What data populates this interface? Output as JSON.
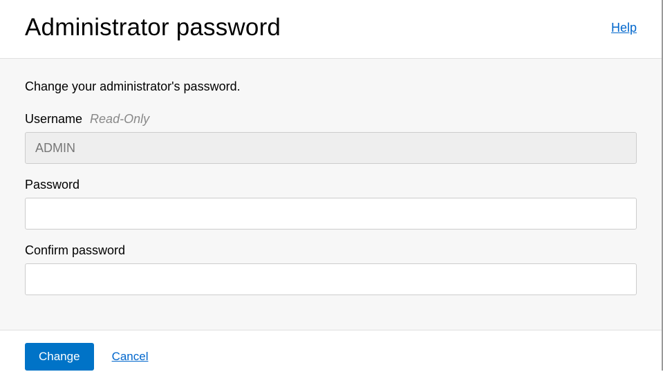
{
  "header": {
    "title": "Administrator password",
    "help_label": "Help"
  },
  "form": {
    "description": "Change your administrator's password.",
    "username": {
      "label": "Username",
      "hint": "Read-Only",
      "value": "ADMIN"
    },
    "password": {
      "label": "Password",
      "value": ""
    },
    "confirm_password": {
      "label": "Confirm password",
      "value": ""
    }
  },
  "footer": {
    "change_label": "Change",
    "cancel_label": "Cancel"
  }
}
